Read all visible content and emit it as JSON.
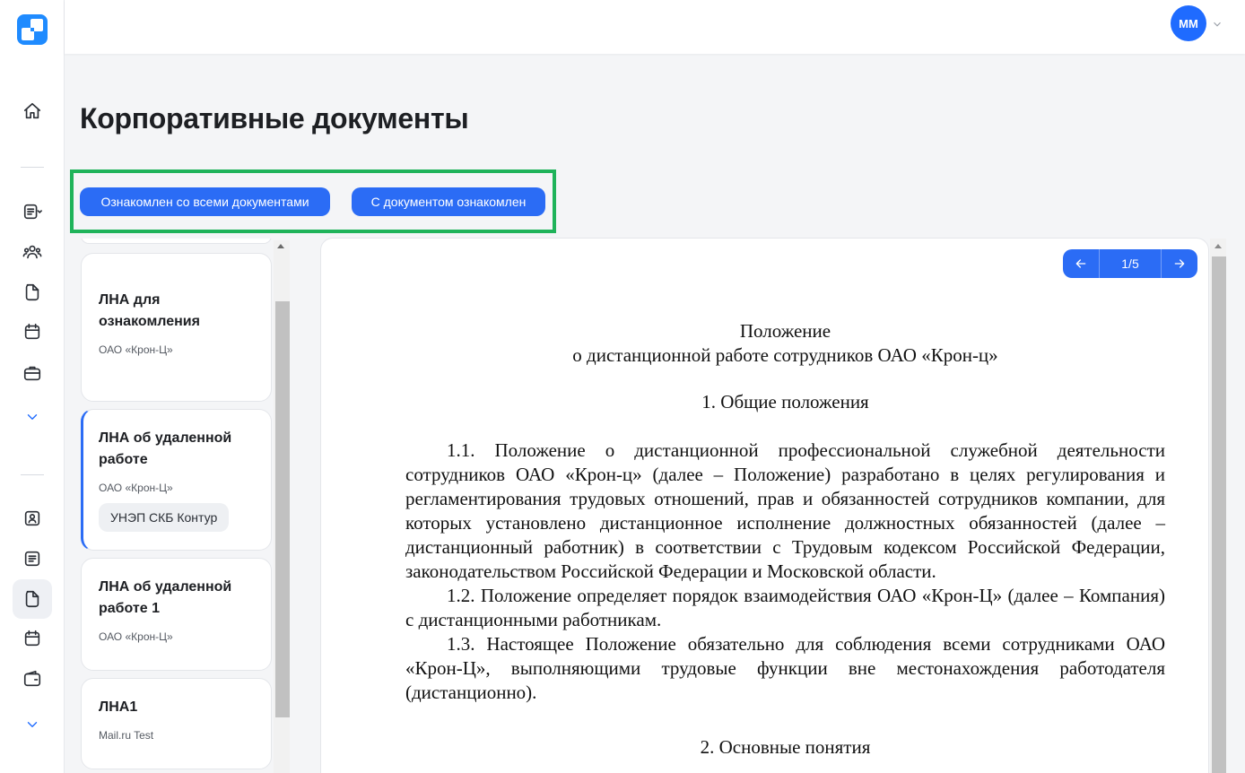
{
  "header": {
    "avatar_initials": "ММ"
  },
  "page": {
    "title": "Корпоративные документы"
  },
  "actions": {
    "acknowledge_all_label": "Ознакомлен со всеми документами",
    "acknowledge_one_label": "С документом ознакомлен"
  },
  "documents": [
    {
      "title": "ЛНА для ознакомления",
      "org": "ОАО «Крон-Ц»",
      "tag": ""
    },
    {
      "title": "ЛНА об удаленной работе",
      "org": "ОАО «Крон-Ц»",
      "tag": "УНЭП СКБ Контур"
    },
    {
      "title": "ЛНА об удаленной работе 1",
      "org": "ОАО «Крон-Ц»",
      "tag": ""
    },
    {
      "title": "ЛНА1",
      "org": "Mail.ru Test",
      "tag": ""
    }
  ],
  "viewer": {
    "page_indicator": "1/5",
    "doc_title_line1": "Положение",
    "doc_title_line2": "о дистанционной работе сотрудников ОАО «Крон-ц»",
    "section1_heading": "1. Общие положения",
    "p1_1": "1.1. Положение о дистанционной профессиональной служебной деятельности сотрудников ОАО «Крон-ц» (далее – Положение) разработано в целях регулирования и регламентирования трудовых отношений, прав и обязанностей сотрудников компании, для которых установлено дистанционное исполнение должностных обязанностей (далее – дистанционный работник)   в соответствии с Трудовым кодексом Российской Федерации, законодательством Российской Федерации и Московской области.",
    "p1_2": "1.2. Положение определяет порядок взаимодействия ОАО «Крон-Ц» (далее – Компания) с дистанционными работникам.",
    "p1_3": "1.3. Настоящее Положение обязательно для соблюдения всеми сотрудниками ОАО «Крон-Ц», выполняющими трудовые функции вне местонахождения работодателя (дистанционно).",
    "section2_heading": "2. Основные понятия"
  },
  "colors": {
    "accent": "#2b6cf5",
    "highlight_frame": "#1fb35a"
  },
  "icons": [
    "app-logo-icon",
    "home-icon",
    "documents-menu-icon",
    "team-icon",
    "file-icon",
    "calendar-icon",
    "briefcase-icon",
    "chevron-down-icon",
    "profile-icon",
    "list-icon",
    "wallet-icon",
    "arrow-left-icon",
    "arrow-right-icon"
  ]
}
